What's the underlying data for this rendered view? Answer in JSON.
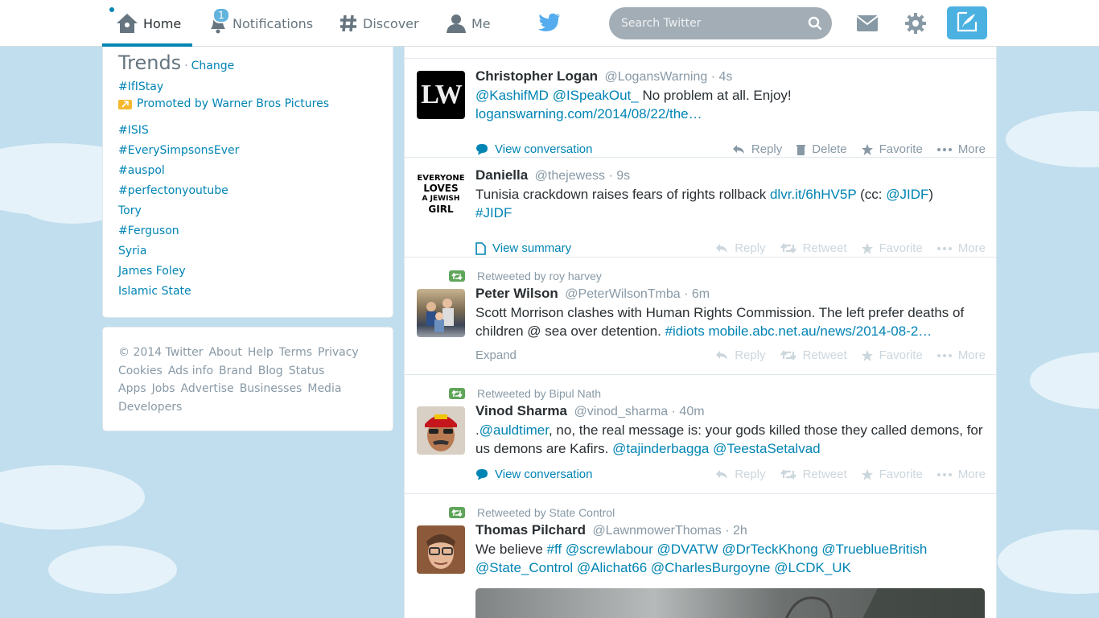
{
  "nav": {
    "home": "Home",
    "notifications": "Notifications",
    "notif_count": "1",
    "discover": "Discover",
    "me": "Me",
    "search_placeholder": "Search Twitter"
  },
  "trends": {
    "title": "Trends",
    "separator": "·",
    "change": "Change",
    "items": [
      "#IfIStay",
      "#ISIS",
      "#EverySimpsonsEver",
      "#auspol",
      "#perfectonyoutube",
      "Tory",
      "#Ferguson",
      "Syria",
      "James Foley",
      "Islamic State"
    ],
    "promoted": "Promoted by Warner Bros Pictures"
  },
  "footer": {
    "links": [
      "© 2014 Twitter",
      "About",
      "Help",
      "Terms",
      "Privacy",
      "Cookies",
      "Ads info",
      "Brand",
      "Blog",
      "Status",
      "Apps",
      "Jobs",
      "Advertise",
      "Businesses",
      "Media",
      "Developers"
    ]
  },
  "tweets": [
    {
      "name": "Christopher Logan",
      "handle": "@LogansWarning",
      "time": "· 4s",
      "text_parts": [
        "@KashifMD",
        " ",
        "@ISpeakOut_",
        " No problem at all. Enjoy!",
        "loganswarning.com/2014/08/22/the…"
      ],
      "meta": "View conversation",
      "actions": [
        "Reply",
        "Delete",
        "Favorite",
        "More"
      ]
    },
    {
      "name": "Daniella",
      "handle": "@thejewess",
      "time": "· 9s",
      "text_parts": [
        "Tunisia crackdown raises fears of rights rollback ",
        "dlvr.it/6hHV5P",
        " (cc: ",
        "@JIDF",
        ")",
        "#JIDF"
      ],
      "meta": "View summary",
      "actions": [
        "Reply",
        "Retweet",
        "Favorite",
        "More"
      ]
    },
    {
      "retweeted_by": "Retweeted by roy harvey",
      "name": "Peter Wilson",
      "handle": "@PeterWilsonTmba",
      "time": "· 6m",
      "text_parts": [
        "Scott Morrison clashes with Human Rights Commission. The left prefer deaths of children @ sea over detention. ",
        "#idiots",
        " ",
        "mobile.abc.net.au/news/2014-08-2…"
      ],
      "meta": "Expand",
      "actions": [
        "Reply",
        "Retweet",
        "Favorite",
        "More"
      ]
    },
    {
      "retweeted_by": "Retweeted by Bipul Nath",
      "name": "Vinod Sharma",
      "handle": "@vinod_sharma",
      "time": "· 40m",
      "text_parts": [
        ".",
        "@auldtimer",
        ", no, the real message is: your gods killed those they called demons, for us demons are Kafirs. ",
        "@tajinderbagga",
        " ",
        "@TeestaSetalvad"
      ],
      "meta": "View conversation",
      "actions": [
        "Reply",
        "Retweet",
        "Favorite",
        "More"
      ]
    },
    {
      "retweeted_by": "Retweeted by State Control",
      "name": "Thomas Pilchard",
      "handle": "@LawnmowerThomas",
      "time": "· 2h",
      "text_parts": [
        "We believe ",
        "#ff",
        " ",
        "@screwlabour",
        " ",
        "@DVATW",
        " ",
        "@DrTeckKhong",
        " ",
        "@TrueblueBritish",
        "@State_Control",
        " ",
        "@Alichat66",
        " ",
        "@CharlesBurgoyne",
        " ",
        "@LCDK_UK"
      ]
    }
  ],
  "avatar_labels": {
    "logan": "LW",
    "daniella_lines": [
      "EVERYONE",
      "LOVES",
      "A JEWISH",
      "GIRL"
    ]
  },
  "colors": {
    "link": "#0084b4",
    "background": "#c0deed",
    "retweet_green": "#5fa55a",
    "compose": "#4bb1e0"
  }
}
